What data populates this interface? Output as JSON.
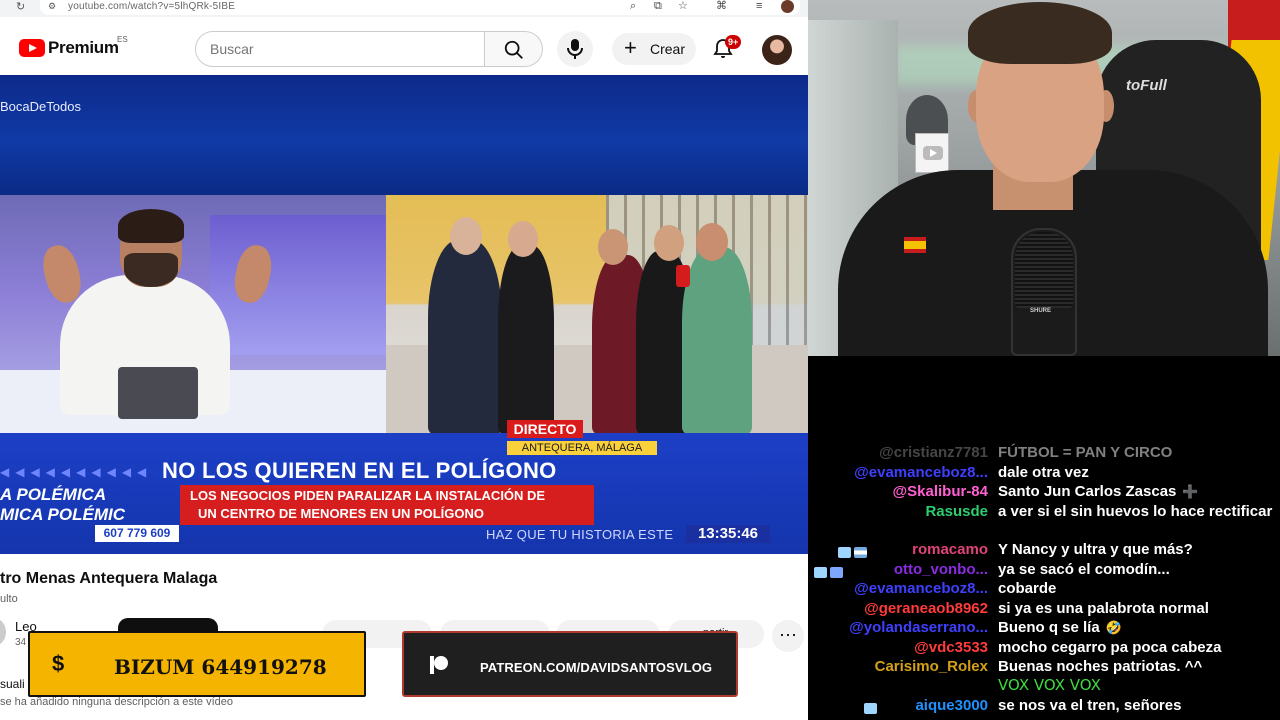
{
  "browser": {
    "url": "youtube.com/watch?v=5lhQRk-5IBE"
  },
  "youtube": {
    "brand": "Premium",
    "country": "ES",
    "search_placeholder": "Buscar",
    "create_label": "Crear",
    "notification_count": "9+"
  },
  "video": {
    "hashtag": "BocaDeTodos",
    "live_label": "DIRECTO",
    "location": "ANTEQUERA, MÁLAGA",
    "headline": "NO LOS QUIEREN EN EL POLÍGONO",
    "subline1": "LOS NEGOCIOS PIDEN PARALIZAR LA INSTALACIÓN DE",
    "subline2": "UN CENTRO DE MENORES EN UN POLÍGONO",
    "side_tag_1": "A   POLÉMICA",
    "side_tag_2": "MICA   POLÉMIC",
    "phone": "607 779 609",
    "ticker": "HAZ QUE TU HISTORIA ESTE",
    "clock": "13:35:46"
  },
  "watch": {
    "title": "tro Menas Antequera Malaga",
    "subtitle": "ulto",
    "channel_name": "Leo",
    "channel_subs": "34",
    "share_label": "partir",
    "more_label": "⋯",
    "section_label": "suali",
    "description": "se ha añadido ninguna descripción a este vídeo"
  },
  "overlays": {
    "bizum_symbol": "$",
    "bizum_text": "BIZUM 644919278",
    "patreon_text": "PATREON.COM/DAVIDSANTOSVLOG"
  },
  "webcam": {
    "chair_brand": "toFull",
    "mic_brand": "SHURE"
  },
  "chat": [
    {
      "user": "@cristianz7781",
      "user_color": "#8c8c8c",
      "msg": "FÚTBOL = PAN Y CIRCO",
      "badges": ""
    },
    {
      "user": "@evamanceboz8...",
      "user_color": "#3f3fff",
      "msg": "dale otra vez",
      "badges": ""
    },
    {
      "user": "@Skalibur-84",
      "user_color": "#ff5fd2",
      "msg": "Santo Jun Carlos Zascas",
      "badges": "",
      "emote": "➕"
    },
    {
      "user": "Rasusde",
      "user_color": "#2ecc71",
      "msg": "a ver si el sin huevos lo hace rectificar",
      "badges": ""
    },
    {
      "user": "romacamo",
      "user_color": "#e0447a",
      "msg": "Y Nancy y ultra y que más?",
      "badges": "diamond-flag"
    },
    {
      "user": "otto_vonbo...",
      "user_color": "#8a2be2",
      "msg": "ya se sacó el comodín...",
      "badges": "diamond-gift"
    },
    {
      "user": "@evamanceboz8...",
      "user_color": "#3f3fff",
      "msg": "cobarde",
      "badges": ""
    },
    {
      "user": "@geraneaob8962",
      "user_color": "#ff3b3b",
      "msg": "si ya es una palabrota normal",
      "badges": ""
    },
    {
      "user": "@yolandaserrano...",
      "user_color": "#3f3fff",
      "msg": "Bueno q se lía",
      "badges": "",
      "emote": "🤣"
    },
    {
      "user": "@vdc3533",
      "user_color": "#ff3b3b",
      "msg": "mocho cegarro pa poca cabeza",
      "badges": ""
    },
    {
      "user": "Carisimo_Rolex",
      "user_color": "#d4a017",
      "msg": "Buenas noches patriotas. ^^",
      "badges": ""
    },
    {
      "user": "",
      "user_color": "#2ecc40",
      "msg": "VOX VOX VOX",
      "badges": "",
      "msg_color": "#3ddc3d"
    },
    {
      "user": "aique3000",
      "user_color": "#1e90ff",
      "msg": "se nos va el tren, señores",
      "badges": "diamond"
    }
  ]
}
